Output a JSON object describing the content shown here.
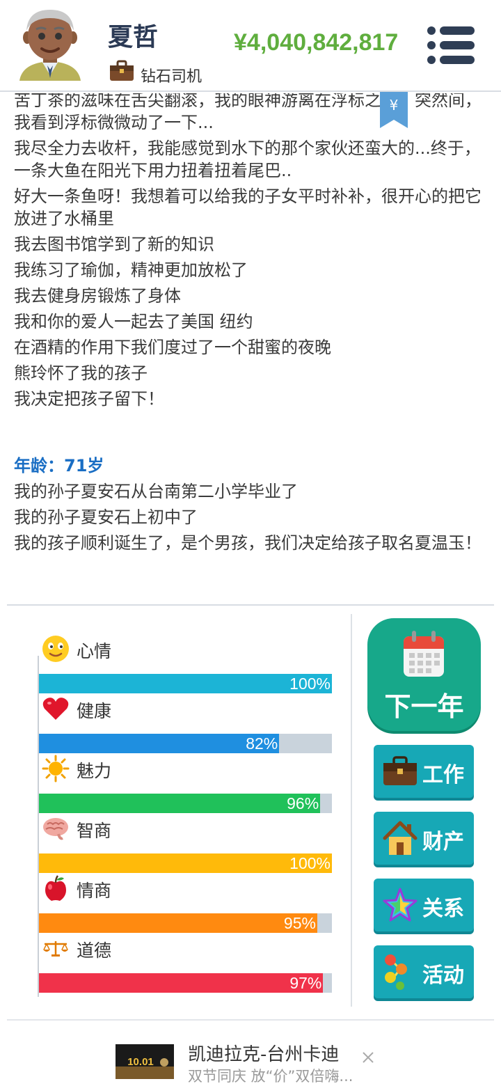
{
  "header": {
    "name": "夏哲",
    "job": "钻石司机",
    "money": "¥4,040,842,817",
    "menu_icon": "hamburger-icon"
  },
  "bookmark_symbol": "¥",
  "log": {
    "lines_top": [
      "苦丁茶的滋味在舌尖翻滚，我的眼神游离在浮标之上。突然间，我看到浮标微微动了一下...",
      "我尽全力去收杆，我能感觉到水下的那个家伙还蛮大的...终于，一条大鱼在阳光下用力扭着扭着尾巴..",
      "好大一条鱼呀！我想着可以给我的子女平时补补，很开心的把它放进了水桶里",
      "我去图书馆学到了新的知识",
      "我练习了瑜伽，精神更加放松了",
      "我去健身房锻炼了身体",
      "我和你的爱人一起去了美国 纽约",
      "在酒精的作用下我们度过了一个甜蜜的夜晚",
      "熊玲怀了我的孩子",
      "我决定把孩子留下！"
    ],
    "age_label": "年龄：71岁",
    "lines_bottom": [
      "我的孙子夏安石从台南第二小学毕业了",
      "我的孙子夏安石上初中了",
      "我的孩子顺利诞生了，是个男孩，我们决定给孩子取名夏温玉！"
    ]
  },
  "stats": [
    {
      "name": "心情",
      "value": 100,
      "label": "100%",
      "color": "#1cb4d6",
      "icon": "smiley-icon"
    },
    {
      "name": "健康",
      "value": 82,
      "label": "82%",
      "color": "#1f8fe0",
      "icon": "heart-icon"
    },
    {
      "name": "魅力",
      "value": 96,
      "label": "96%",
      "color": "#20c15a",
      "icon": "sun-icon"
    },
    {
      "name": "智商",
      "value": 100,
      "label": "100%",
      "color": "#ffba0a",
      "icon": "brain-icon"
    },
    {
      "name": "情商",
      "value": 95,
      "label": "95%",
      "color": "#ff8a10",
      "icon": "apple-icon"
    },
    {
      "name": "道德",
      "value": 97,
      "label": "97%",
      "color": "#f0324a",
      "icon": "scales-icon"
    }
  ],
  "buttons": {
    "next_year": "下一年",
    "work": "工作",
    "property": "财产",
    "relations": "关系",
    "activities": "活动"
  },
  "ad": {
    "title": "凯迪拉克-台州卡迪",
    "subtitle": "双节同庆 放“价”双倍嗨...",
    "image_text": "10.01"
  }
}
